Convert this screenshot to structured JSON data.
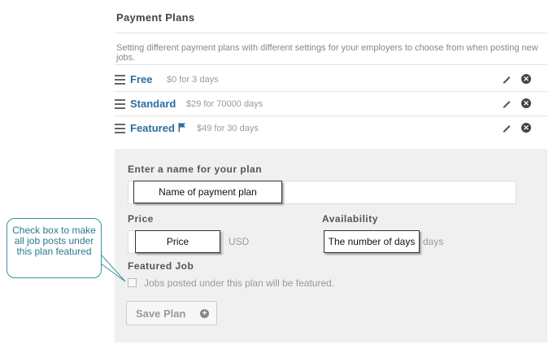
{
  "section": {
    "title": "Payment Plans",
    "description": "Setting different payment plans with different settings for your employers to choose from when posting new jobs."
  },
  "plans": [
    {
      "name": "Free",
      "price": "$0 for 3 days",
      "featured": false
    },
    {
      "name": "Standard",
      "price": "$29 for 70000 days",
      "featured": false
    },
    {
      "name": "Featured",
      "price": "$49 for 30 days",
      "featured": true
    }
  ],
  "form": {
    "name_label": "Enter a name for your plan",
    "name_callout": "Name of payment plan",
    "price_label": "Price",
    "price_callout": "Price",
    "price_unit": "USD",
    "availability_label": "Availability",
    "availability_callout": "The number of days",
    "availability_unit": "days",
    "featured_label": "Featured Job",
    "featured_checkbox_text": "Jobs posted under this plan will be featured.",
    "featured_checked": false,
    "save_label": "Save Plan"
  },
  "annotation": {
    "text": "Check box to make all job posts under this plan featured"
  },
  "colors": {
    "plan_name": "#2c6e9e",
    "panel_bg": "#f0f0f0",
    "annotation": "#3a8fa3"
  }
}
